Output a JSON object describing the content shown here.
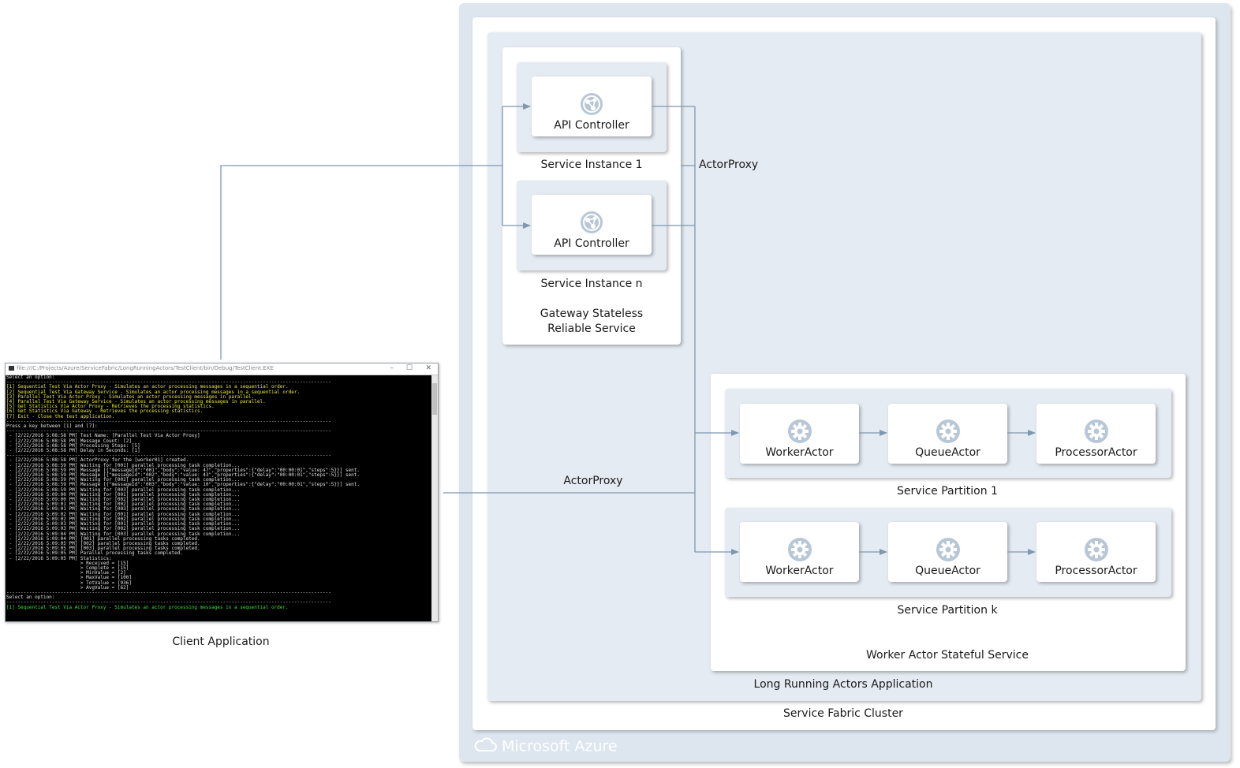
{
  "colors": {
    "background_outer": "#dde6ef",
    "panel": "#e5ebf2",
    "card": "#ffffff",
    "connector": "#7f98ae"
  },
  "azure": {
    "logo_text": "Microsoft Azure",
    "cloud_icon": "cloud-icon"
  },
  "cluster": {
    "label": "Service Fabric Cluster"
  },
  "application": {
    "label": "Long Running Actors Application"
  },
  "gateway": {
    "label_line1": "Gateway Stateless",
    "label_line2": "Reliable Service",
    "instances": [
      {
        "label": "Service Instance 1",
        "card_label": "API Controller",
        "icon": "api-icon"
      },
      {
        "label": "Service Instance n",
        "card_label": "API Controller",
        "icon": "api-icon"
      }
    ]
  },
  "worker_service": {
    "label": "Worker Actor Stateful Service",
    "partitions": [
      {
        "label": "Service Partition 1",
        "actors": [
          "WorkerActor",
          "QueueActor",
          "ProcessorActor"
        ]
      },
      {
        "label": "Service Partition k",
        "actors": [
          "WorkerActor",
          "QueueActor",
          "ProcessorActor"
        ]
      }
    ]
  },
  "edges": {
    "actor_proxy_upper": "ActorProxy",
    "actor_proxy_lower": "ActorProxy"
  },
  "client": {
    "label": "Client Application",
    "window_title": "file:///C:/Projects/Azure/ServiceFabric/LongRunningActors/TestClient/bin/Debug/TestClient.EXE",
    "console_lines": [
      {
        "c": "w",
        "t": "Select an option:"
      },
      {
        "c": "w",
        "t": "------------------------------------------------------------------------------------------------------------------"
      },
      {
        "c": "y",
        "t": "[1] Sequential Test Via Actor Proxy - Simulates an actor processing messages in a sequential order."
      },
      {
        "c": "y",
        "t": "[2] Sequential Test Via Gateway Service - Simulates an actor processing messages in a sequential order."
      },
      {
        "c": "y",
        "t": "[3] Parallel Test Via Actor Proxy - Simulates an actor processing messages in parallel."
      },
      {
        "c": "y",
        "t": "[4] Parallel Test Via Gateway Service - Simulates an actor processing messages in parallel."
      },
      {
        "c": "y",
        "t": "[5] Get Statistics Via Actor Proxy - Retrieves the processing statistics."
      },
      {
        "c": "y",
        "t": "[6] Get Statistics Via Gateway - Retrieves the processing statistics."
      },
      {
        "c": "y",
        "t": "[7] Exit - Close the test application."
      },
      {
        "c": "w",
        "t": "------------------------------------------------------------------------------------------------------------------"
      },
      {
        "c": "w",
        "t": "Press a key between [1] and [7]:"
      },
      {
        "c": "w",
        "t": "------------------------------------------------------------------------------------------------------------------"
      },
      {
        "c": "w",
        "t": " - [2/22/2016 5:08:58 PM] Test Name: [Parallel Test Via Actor Proxy]"
      },
      {
        "c": "w",
        "t": " - [2/22/2016 5:08:58 PM] Message Count: [2]"
      },
      {
        "c": "w",
        "t": " - [2/22/2016 5:08:58 PM] Processing Steps: [5]"
      },
      {
        "c": "w",
        "t": " - [2/22/2016 5:08:58 PM] Delay in Seconds: [1]"
      },
      {
        "c": "w",
        "t": "------------------------------------------------------------------------------------------------------------------"
      },
      {
        "c": "w",
        "t": " - [2/22/2016 5:08:58 PM] ActorProxy for the [worker01] created."
      },
      {
        "c": "w",
        "t": " - [2/22/2016 5:08:59 PM] Waiting for [001] parallel processing task completion..."
      },
      {
        "c": "w",
        "t": " - [2/22/2016 5:08:59 PM] Message [{\"messageId\":\"001\",\"body\":\"value: 47\",\"properties\":{\"delay\":\"00:00:01\",\"steps\":5}}] sent."
      },
      {
        "c": "w",
        "t": " - [2/22/2016 5:08:59 PM] Message [{\"messageId\":\"002\",\"body\":\"value: 43\",\"properties\":{\"delay\":\"00:00:01\",\"steps\":5}}] sent."
      },
      {
        "c": "w",
        "t": " - [2/22/2016 5:08:59 PM] Waiting for [002] parallel processing task completion..."
      },
      {
        "c": "w",
        "t": " - [2/22/2016 5:08:59 PM] Message [{\"messageId\":\"003\",\"body\":\"value: 10\",\"properties\":{\"delay\":\"00:00:01\",\"steps\":5}}] sent."
      },
      {
        "c": "w",
        "t": " - [2/22/2016 5:08:59 PM] Waiting for [003] parallel processing task completion..."
      },
      {
        "c": "w",
        "t": " - [2/22/2016 5:09:00 PM] Waiting for [001] parallel processing task completion..."
      },
      {
        "c": "w",
        "t": " - [2/22/2016 5:09:00 PM] Waiting for [002] parallel processing task completion..."
      },
      {
        "c": "w",
        "t": " - [2/22/2016 5:09:01 PM] Waiting for [002] parallel processing task completion..."
      },
      {
        "c": "w",
        "t": " - [2/22/2016 5:09:01 PM] Waiting for [003] parallel processing task completion..."
      },
      {
        "c": "w",
        "t": " - [2/22/2016 5:09:02 PM] Waiting for [001] parallel processing task completion..."
      },
      {
        "c": "w",
        "t": " - [2/22/2016 5:09:02 PM] Waiting for [002] parallel processing task completion..."
      },
      {
        "c": "w",
        "t": " - [2/22/2016 5:09:03 PM] Waiting for [001] parallel processing task completion..."
      },
      {
        "c": "w",
        "t": " - [2/22/2016 5:09:03 PM] Waiting for [002] parallel processing task completion..."
      },
      {
        "c": "w",
        "t": " - [2/22/2016 5:09:04 PM] Waiting for [003] parallel processing task completion..."
      },
      {
        "c": "w",
        "t": " - [2/22/2016 5:09:04 PM] [001] parallel processing tasks completed."
      },
      {
        "c": "w",
        "t": " - [2/22/2016 5:09:05 PM] [002] parallel processing tasks completed."
      },
      {
        "c": "w",
        "t": " - [2/22/2016 5:09:05 PM] [003] parallel processing tasks completed."
      },
      {
        "c": "w",
        "t": " - [2/22/2016 5:09:05 PM] Parallel processing tasks completed."
      },
      {
        "c": "w",
        "t": " - [2/22/2016 5:09:05 PM] Statistics:"
      },
      {
        "c": "w",
        "t": "                          > Received = [15]"
      },
      {
        "c": "w",
        "t": "                          > Complete = [15]"
      },
      {
        "c": "w",
        "t": "                          > MinValue = [2]"
      },
      {
        "c": "w",
        "t": "                          > MaxValue = [100]"
      },
      {
        "c": "w",
        "t": "                          > TotValue = [936]"
      },
      {
        "c": "w",
        "t": "                          > AvgValue = [62]"
      },
      {
        "c": "w",
        "t": "------------------------------------------------------------------------------------------------------------------"
      },
      {
        "c": "w",
        "t": "Select an option:"
      },
      {
        "c": "w",
        "t": "------------------------------------------------------------------------------------------------------------------"
      },
      {
        "c": "g",
        "t": "[1] Sequential Test Via Actor Proxy - Simulates an actor processing messages in a sequential order."
      }
    ]
  }
}
